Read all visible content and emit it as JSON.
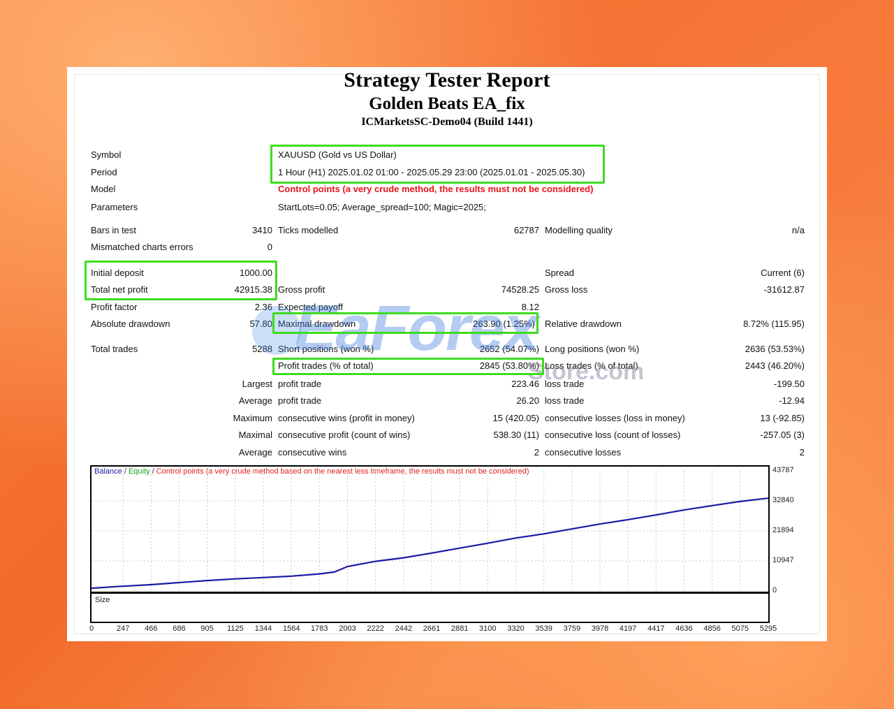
{
  "report": {
    "title": "Strategy Tester Report",
    "ea_name": "Golden Beats EA_fix",
    "server": "ICMarketsSC-Demo04 (Build 1441)"
  },
  "settings": {
    "symbol_label": "Symbol",
    "symbol_value": "XAUUSD (Gold vs US Dollar)",
    "period_label": "Period",
    "period_value": "1 Hour (H1) 2025.01.02 01:00 - 2025.05.29 23:00 (2025.01.01 - 2025.05.30)",
    "model_label": "Model",
    "model_value": "Control points (a very crude method, the results must not be considered)",
    "parameters_label": "Parameters",
    "parameters_value": "StartLots=0.05; Average_spread=100; Magic=2025;"
  },
  "test": {
    "bars_label": "Bars in test",
    "bars_value": "3410",
    "ticks_label": "Ticks modelled",
    "ticks_value": "62787",
    "quality_label": "Modelling quality",
    "quality_value": "n/a",
    "mismatch_label": "Mismatched charts errors",
    "mismatch_value": "0"
  },
  "results": {
    "initial_deposit_label": "Initial deposit",
    "initial_deposit_value": "1000.00",
    "spread_label": "Spread",
    "spread_value": "Current (6)",
    "net_profit_label": "Total net profit",
    "net_profit_value": "42915.38",
    "gross_profit_label": "Gross profit",
    "gross_profit_value": "74528.25",
    "gross_loss_label": "Gross loss",
    "gross_loss_value": "-31612.87",
    "profit_factor_label": "Profit factor",
    "profit_factor_value": "2.36",
    "expected_payoff_label": "Expected payoff",
    "expected_payoff_value": "8.12",
    "abs_dd_label": "Absolute drawdown",
    "abs_dd_value": "57.80",
    "max_dd_label": "Maximal drawdown",
    "max_dd_value": "263.90 (1.25%)",
    "rel_dd_label": "Relative drawdown",
    "rel_dd_value": "8.72% (115.95)"
  },
  "trades": {
    "total_label": "Total trades",
    "total_value": "5288",
    "short_label": "Short positions (won %)",
    "short_value": "2652 (54.07%)",
    "long_label": "Long positions (won %)",
    "long_value": "2636 (53.53%)",
    "profit_trades_label": "Profit trades (% of total)",
    "profit_trades_value": "2845 (53.80%)",
    "loss_trades_label": "Loss trades (% of total)",
    "loss_trades_value": "2443 (46.20%)",
    "largest_label": "Largest",
    "largest_profit_label": "profit trade",
    "largest_profit_value": "223.46",
    "largest_loss_label": "loss trade",
    "largest_loss_value": "-199.50",
    "average_label": "Average",
    "average_profit_label": "profit trade",
    "average_profit_value": "26.20",
    "average_loss_label": "loss trade",
    "average_loss_value": "-12.94",
    "maximum_label": "Maximum",
    "max_wins_label": "consecutive wins (profit in money)",
    "max_wins_value": "15 (420.05)",
    "max_losses_label": "consecutive losses (loss in money)",
    "max_losses_value": "13 (-92.85)",
    "maximal_label": "Maximal",
    "maximal_profit_label": "consecutive profit (count of wins)",
    "maximal_profit_value": "538.30 (11)",
    "maximal_loss_label": "consecutive loss (count of losses)",
    "maximal_loss_value": "-257.05 (3)",
    "avg_cons_label": "Average",
    "avg_cons_wins_label": "consecutive wins",
    "avg_cons_wins_value": "2",
    "avg_cons_losses_label": "consecutive losses",
    "avg_cons_losses_value": "2"
  },
  "watermark": {
    "main": "EaForex",
    "sub": "Store.com"
  },
  "chart_data": {
    "type": "line",
    "legend": {
      "balance": "Balance",
      "equity": "Equity",
      "control": "Control points (a very crude method based on the nearest less timeframe, the results must not be considered)",
      "sep": "/"
    },
    "size_label": "Size",
    "yticks": [
      "43787",
      "32840",
      "21894",
      "10947",
      "0"
    ],
    "ylim": [
      0,
      43787
    ],
    "xticks": [
      "0",
      "247",
      "466",
      "686",
      "905",
      "1125",
      "1344",
      "1564",
      "1783",
      "2003",
      "2222",
      "2442",
      "2661",
      "2881",
      "3100",
      "3320",
      "3539",
      "3759",
      "3978",
      "4197",
      "4417",
      "4636",
      "4856",
      "5075",
      "5295"
    ],
    "xlim": [
      0,
      5295
    ],
    "series": [
      {
        "name": "Balance",
        "color": "#1a1aa6",
        "x": [
          0,
          200,
          466,
          700,
          905,
          1125,
          1344,
          1564,
          1783,
          1900,
          2003,
          2222,
          2442,
          2661,
          2881,
          3100,
          3320,
          3539,
          3759,
          3978,
          4197,
          4417,
          4636,
          4856,
          5075,
          5295
        ],
        "y": [
          1000,
          1600,
          2300,
          3100,
          3800,
          4400,
          4900,
          5400,
          6200,
          6900,
          8900,
          10800,
          12100,
          13800,
          15600,
          17400,
          19300,
          20800,
          22600,
          24400,
          26000,
          27700,
          29500,
          31100,
          32600,
          33800
        ]
      }
    ],
    "size_bars_color": "#18a018"
  }
}
